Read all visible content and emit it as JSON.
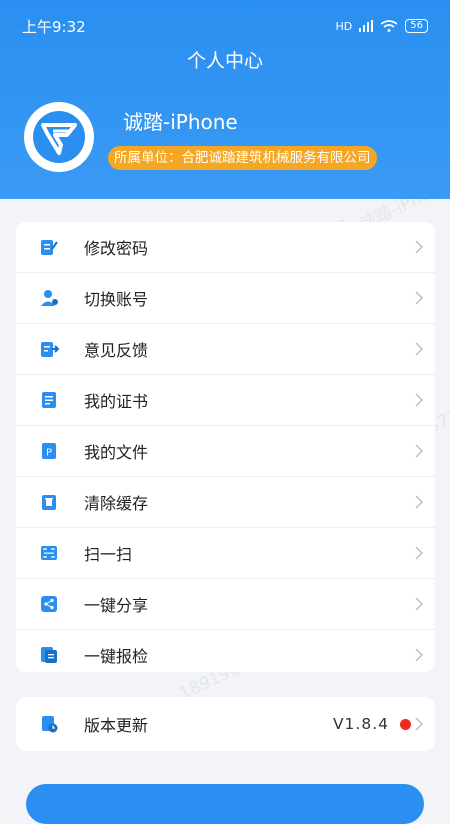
{
  "status_bar": {
    "time": "上午9:32",
    "network": "HD",
    "battery": "56"
  },
  "header": {
    "title": "个人中心",
    "username": "诚踏-iPhone",
    "company": "所属单位：合肥诚踏建筑机械服务有限公司"
  },
  "menu": [
    {
      "label": "修改密码",
      "icon": "edit-doc-icon"
    },
    {
      "label": "切换账号",
      "icon": "switch-user-icon"
    },
    {
      "label": "意见反馈",
      "icon": "feedback-icon"
    },
    {
      "label": "我的证书",
      "icon": "certificate-icon"
    },
    {
      "label": "我的文件",
      "icon": "file-icon"
    },
    {
      "label": "清除缓存",
      "icon": "trash-icon"
    },
    {
      "label": "扫一扫",
      "icon": "scan-icon"
    },
    {
      "label": "一键分享",
      "icon": "share-icon"
    },
    {
      "label": "一键报检",
      "icon": "report-icon"
    }
  ],
  "version": {
    "label": "版本更新",
    "value": "V1.8.4"
  },
  "watermarks": [
    "18919646372",
    "诚踏-iPhone"
  ],
  "colors": {
    "primary": "#2a8ff0",
    "badge": "#f5a623",
    "dot": "#ee2b1c"
  }
}
